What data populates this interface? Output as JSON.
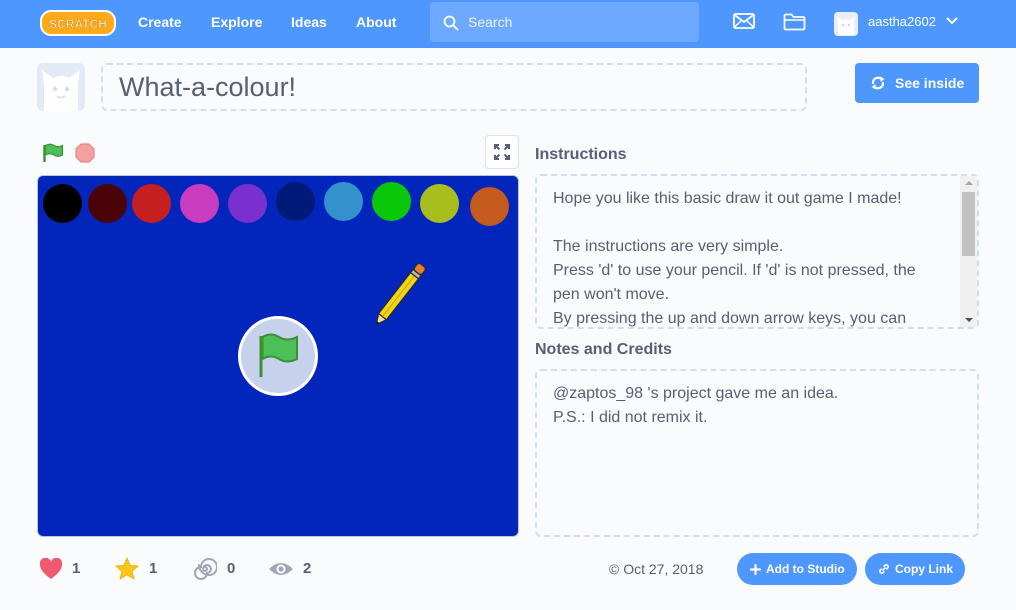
{
  "nav": {
    "logo_text": "SCRATCH",
    "links": [
      "Create",
      "Explore",
      "Ideas",
      "About"
    ],
    "search_placeholder": "Search",
    "username": "aastha2602"
  },
  "project": {
    "title": "What-a-colour!",
    "see_inside_label": "See inside"
  },
  "stage": {
    "palette": [
      "#000000",
      "#4a0408",
      "#c51f1f",
      "#c93bbf",
      "#7a2fcf",
      "#001a7a",
      "#3591cc",
      "#0ac70a",
      "#a8be1c",
      "#c45a1e"
    ]
  },
  "instructions": {
    "label": "Instructions",
    "paragraphs": [
      "Hope you like this basic draw it out game I made!",
      "",
      "The instructions are very simple.",
      "Press 'd' to use your pencil. If 'd' is not pressed, the pen won't move.",
      "By pressing the up and down arrow keys, you can"
    ]
  },
  "notes": {
    "label": "Notes and Credits",
    "paragraphs": [
      "@zaptos_98 's project gave me an idea.",
      "P.S.: I did not remix it."
    ]
  },
  "stats": {
    "loves": "1",
    "favorites": "1",
    "remixes": "0",
    "views": "2"
  },
  "footer": {
    "date": "© Oct 27, 2018",
    "add_to_studio_label": "Add to Studio",
    "copy_link_label": "Copy Link"
  },
  "colors": {
    "brand_blue": "#4d97ff",
    "stage_bg": "#0226bb",
    "love_red": "#ef5a6f",
    "favorite_yellow": "#ffc61a"
  }
}
